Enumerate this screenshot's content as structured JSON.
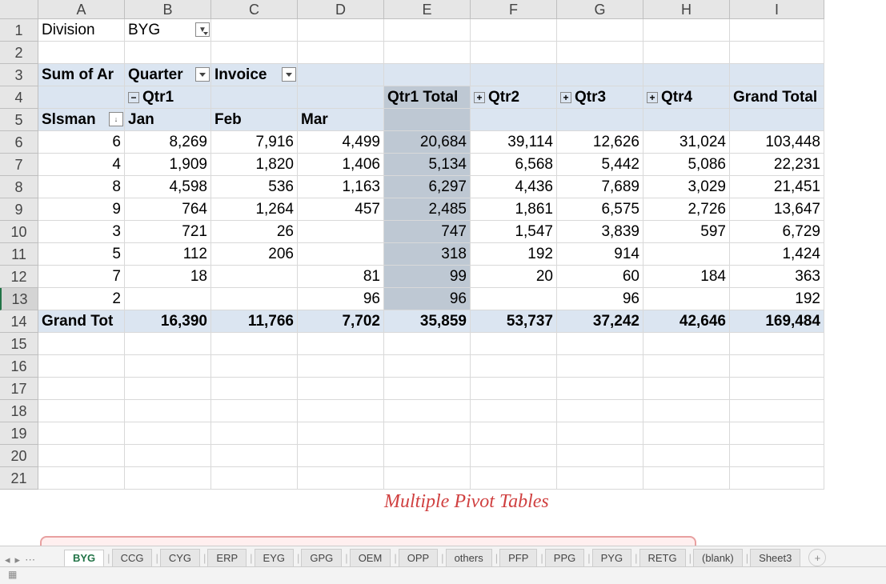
{
  "cols": [
    "A",
    "B",
    "C",
    "D",
    "E",
    "F",
    "G",
    "H",
    "I"
  ],
  "rows": [
    "1",
    "2",
    "3",
    "4",
    "5",
    "6",
    "7",
    "8",
    "9",
    "10",
    "11",
    "12",
    "13",
    "14",
    "15",
    "16",
    "17",
    "18",
    "19",
    "20",
    "21"
  ],
  "filter": {
    "label": "Division",
    "value": "BYG"
  },
  "pivot_headers": {
    "sum_of": "Sum of Amount",
    "quarter": "Quarter",
    "invoice": "Invoice",
    "qtr1": "Qtr1",
    "qtr1_total": "Qtr1 Total",
    "qtr2": "Qtr2",
    "qtr3": "Qtr3",
    "qtr4": "Qtr4",
    "grand_total": "Grand Total",
    "slsman": "Slsman",
    "jan": "Jan",
    "feb": "Feb",
    "mar": "Mar",
    "grand_row": "Grand Total"
  },
  "data_rows": [
    {
      "slsman": "6",
      "jan": "8,269",
      "feb": "7,916",
      "mar": "4,499",
      "q1t": "20,684",
      "q2": "39,114",
      "q3": "12,626",
      "q4": "31,024",
      "gt": "103,448"
    },
    {
      "slsman": "4",
      "jan": "1,909",
      "feb": "1,820",
      "mar": "1,406",
      "q1t": "5,134",
      "q2": "6,568",
      "q3": "5,442",
      "q4": "5,086",
      "gt": "22,231"
    },
    {
      "slsman": "8",
      "jan": "4,598",
      "feb": "536",
      "mar": "1,163",
      "q1t": "6,297",
      "q2": "4,436",
      "q3": "7,689",
      "q4": "3,029",
      "gt": "21,451"
    },
    {
      "slsman": "9",
      "jan": "764",
      "feb": "1,264",
      "mar": "457",
      "q1t": "2,485",
      "q2": "1,861",
      "q3": "6,575",
      "q4": "2,726",
      "gt": "13,647"
    },
    {
      "slsman": "3",
      "jan": "721",
      "feb": "26",
      "mar": "",
      "q1t": "747",
      "q2": "1,547",
      "q3": "3,839",
      "q4": "597",
      "gt": "6,729"
    },
    {
      "slsman": "5",
      "jan": "112",
      "feb": "206",
      "mar": "",
      "q1t": "318",
      "q2": "192",
      "q3": "914",
      "q4": "",
      "gt": "1,424"
    },
    {
      "slsman": "7",
      "jan": "18",
      "feb": "",
      "mar": "81",
      "q1t": "99",
      "q2": "20",
      "q3": "60",
      "q4": "184",
      "gt": "363"
    },
    {
      "slsman": "2",
      "jan": "",
      "feb": "",
      "mar": "96",
      "q1t": "96",
      "q2": "",
      "q3": "96",
      "q4": "",
      "gt": "192"
    }
  ],
  "grand_row": {
    "jan": "16,390",
    "feb": "11,766",
    "mar": "7,702",
    "q1t": "35,859",
    "q2": "53,737",
    "q3": "37,242",
    "q4": "42,646",
    "gt": "169,484"
  },
  "tabs": [
    "BYG",
    "CCG",
    "CYG",
    "ERP",
    "EYG",
    "GPG",
    "OEM",
    "OPP",
    "others",
    "PFP",
    "PPG",
    "PYG",
    "RETG",
    "(blank)",
    "Sheet3"
  ],
  "active_tab": "BYG",
  "highlight_end_index": 12,
  "annotation": "Multiple Pivot Tables"
}
